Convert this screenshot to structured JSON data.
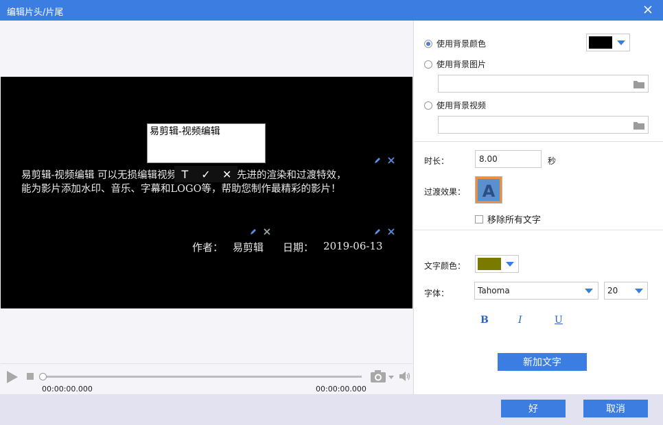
{
  "window": {
    "title": "编辑片头/片尾"
  },
  "preview": {
    "textbox_content": "易剪辑-视频编辑",
    "floating_toolbar": {
      "text_icon": "T",
      "confirm_icon": "✓",
      "cancel_icon": "✕"
    },
    "body_line1": "易剪辑-视频编辑 可以无损编辑视频，并提供了最先进的渲染和过渡特效，",
    "body_line2": "能为影片添加水印、音乐、字幕和LOGO等，帮助您制作最精彩的影片！",
    "author_label": "作者：",
    "author_value": "易剪辑",
    "date_label": "日期：",
    "date_value": "2019-06-13"
  },
  "playback": {
    "time_current": "00:00:00.000",
    "time_total": "00:00:00.000",
    "progress": 0
  },
  "background": {
    "option_color": "使用背景颜色",
    "option_image": "使用背景图片",
    "option_video": "使用背景视频",
    "selected": "color",
    "color_value": "#000000",
    "image_path": "",
    "video_path": ""
  },
  "duration": {
    "label": "时长：",
    "value": "8.00",
    "unit": "秒"
  },
  "transition": {
    "label": "过渡效果：",
    "thumbnail_letter": "A"
  },
  "remove_all_text": {
    "label": "移除所有文字",
    "checked": false
  },
  "text_color": {
    "label": "文字颜色：",
    "value": "#7b7a00"
  },
  "font": {
    "label": "字体：",
    "family": "Tahoma",
    "size": "20"
  },
  "format": {
    "bold": "B",
    "italic": "I",
    "underline": "U"
  },
  "add_text_button": "新加文字",
  "footer": {
    "ok": "好",
    "cancel": "取消"
  },
  "colors": {
    "accent": "#3b7de0",
    "panel": "#ffffff",
    "canvas": "#000000"
  }
}
